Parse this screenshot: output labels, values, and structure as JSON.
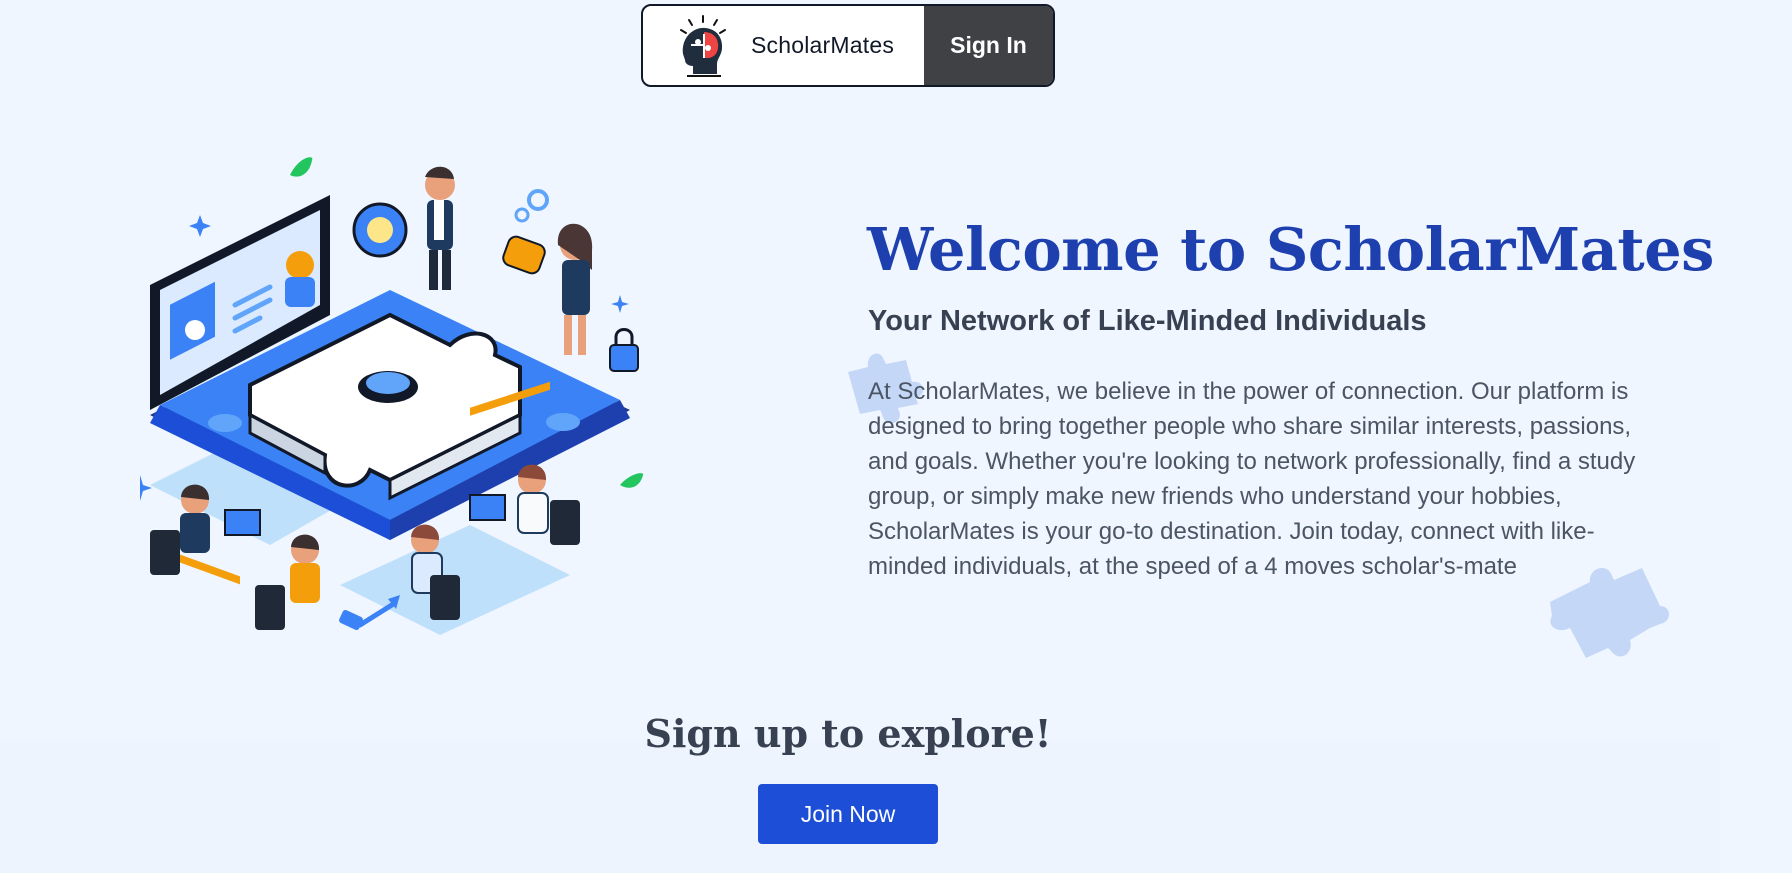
{
  "nav": {
    "brand_name": "ScholarMates",
    "logo_icon": "puzzle-head-icon",
    "signin_label": "Sign In"
  },
  "hero": {
    "title": "Welcome to ScholarMates",
    "subtitle": "Your Network of Like-Minded Individuals",
    "body": "At ScholarMates, we believe in the power of connection. Our platform is designed to bring together people who share similar interests, passions, and goals. Whether you're looking to network professionally, find a study group, or simply make new friends who understand your hobbies, ScholarMates is your go-to destination. Join today, connect with like-minded individuals, at the speed of a 4 moves scholar's-mate",
    "illustration_icon": "team-puzzle-illustration"
  },
  "cta": {
    "title": "Sign up to explore!",
    "button_label": "Join Now"
  },
  "colors": {
    "background": "#eff6ff",
    "title": "#1e40af",
    "button": "#1d4ed8",
    "signin_bg": "#404145",
    "puzzle_blue": "#3b82f6",
    "deco_puzzle": "#bfd4f6"
  }
}
